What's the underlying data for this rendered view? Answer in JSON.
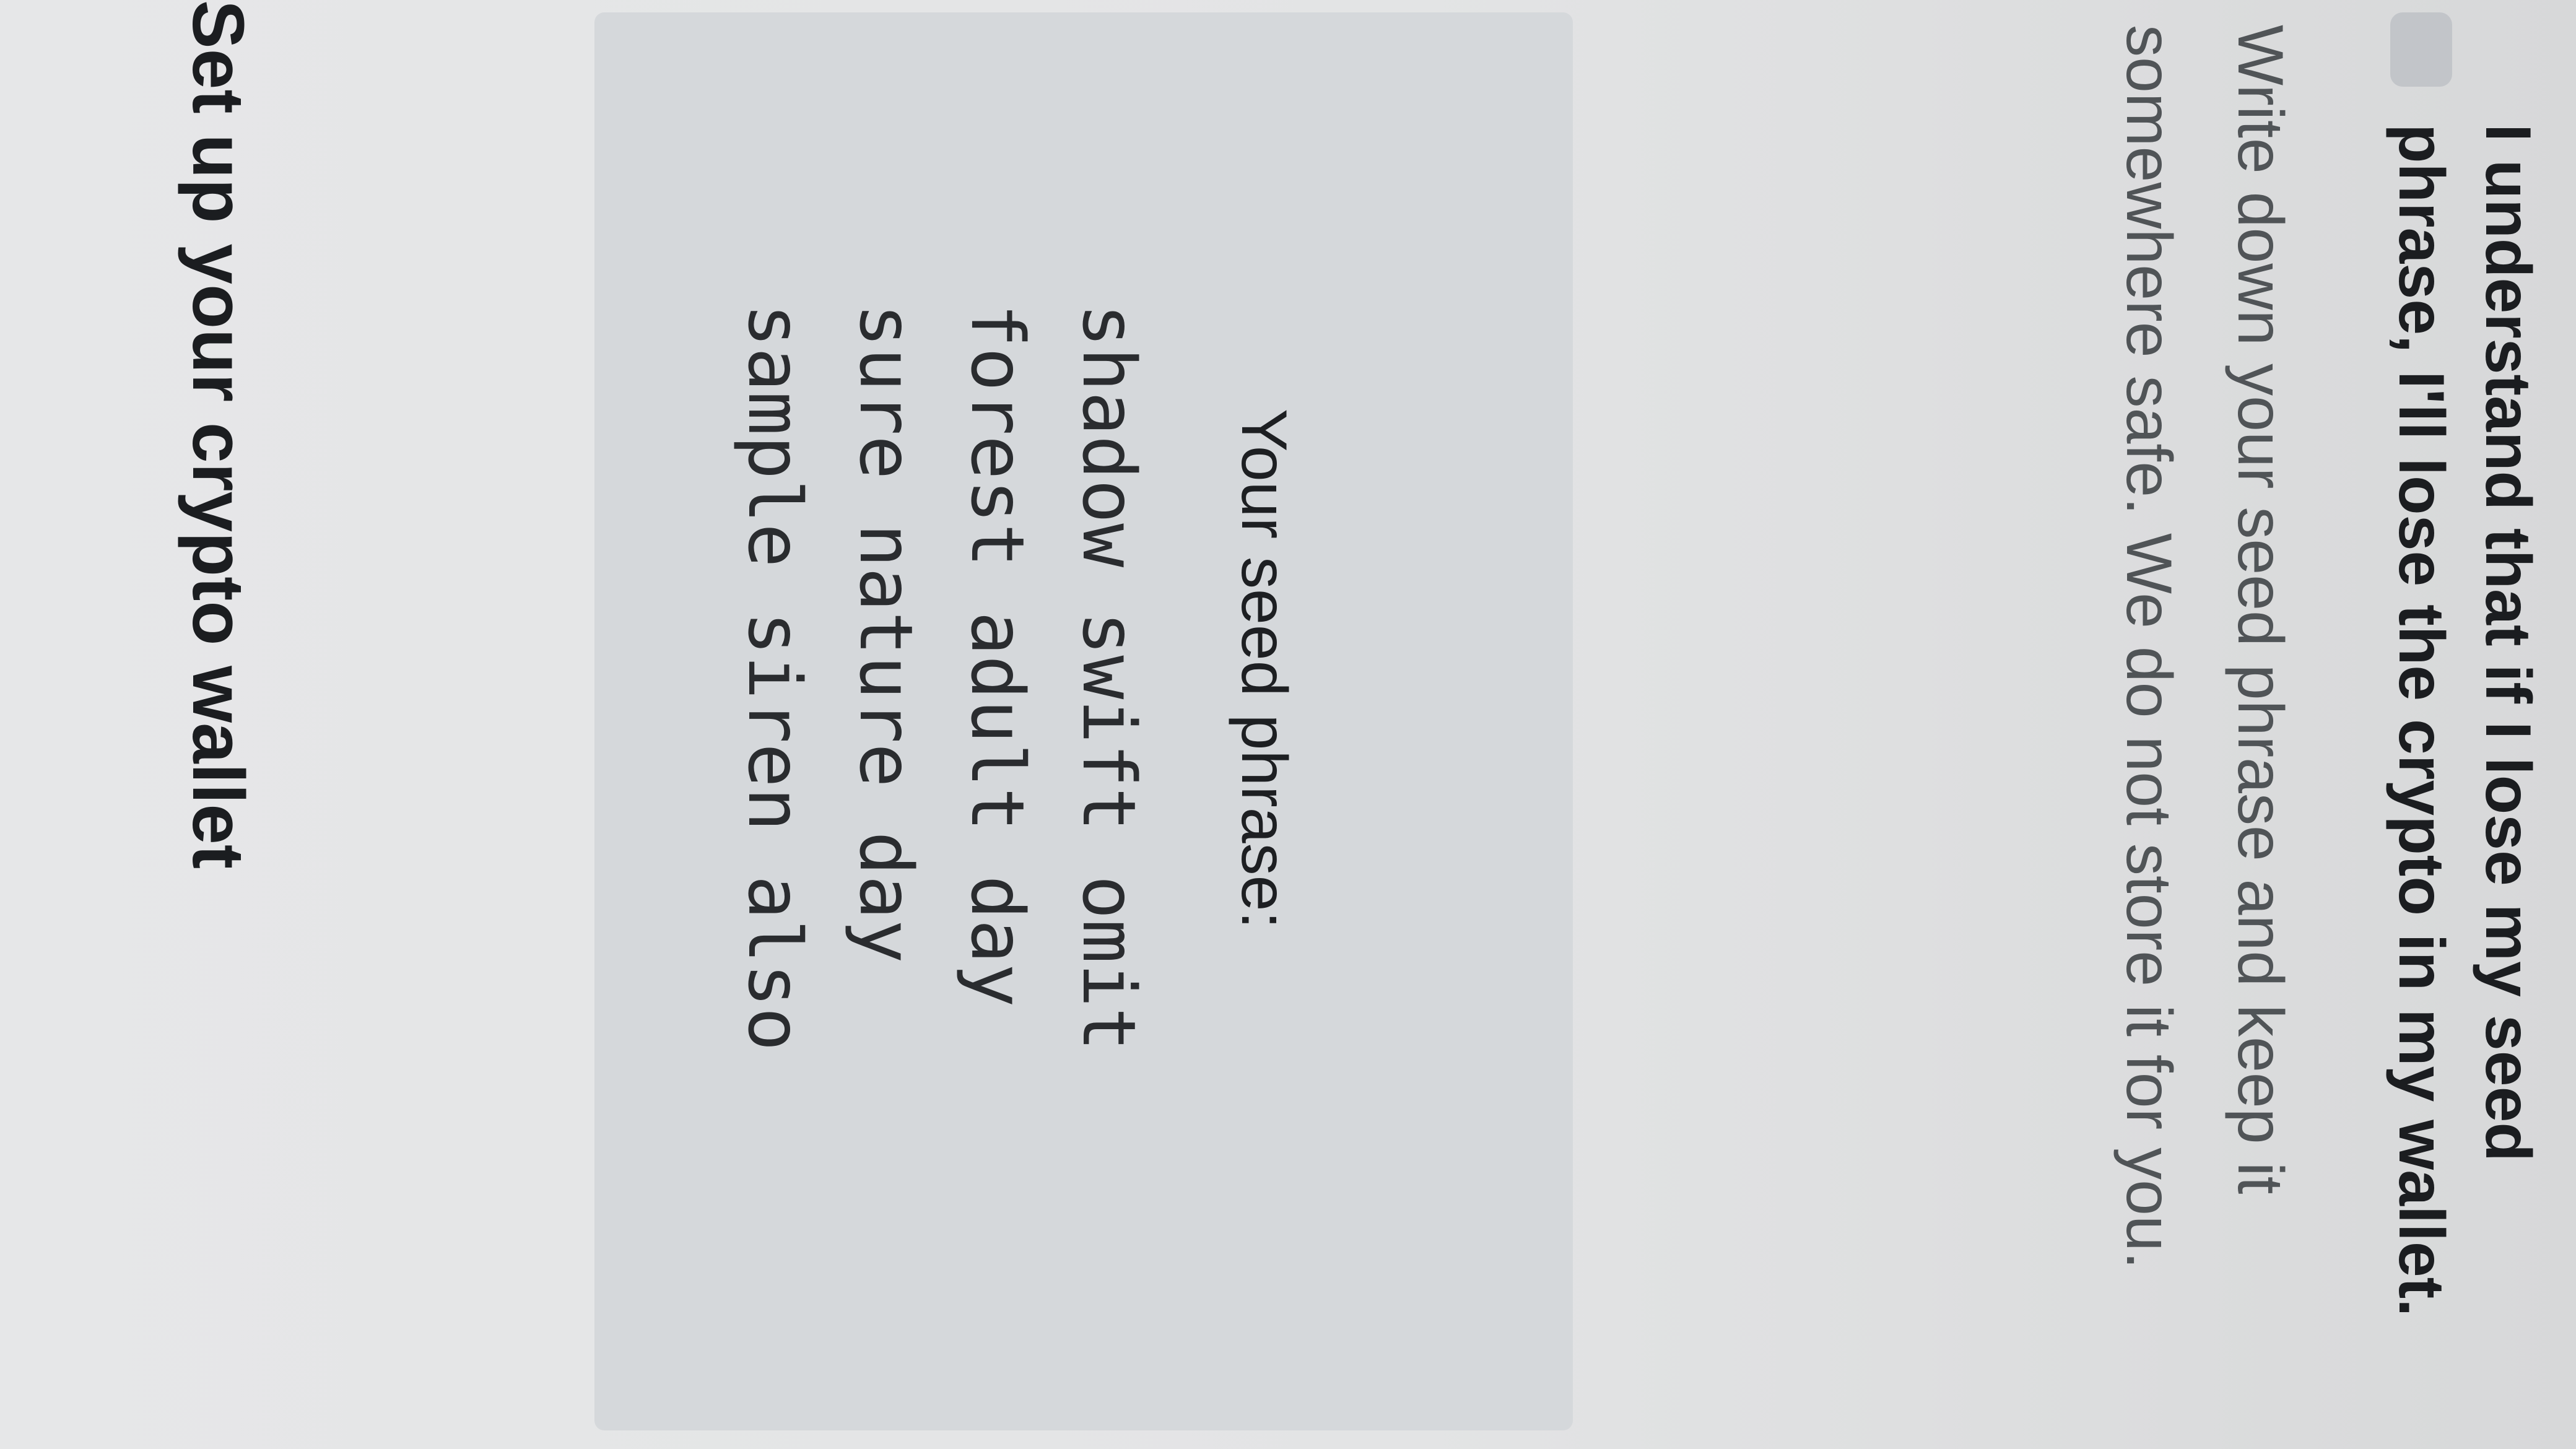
{
  "title": "Set up your crypto wallet",
  "seed": {
    "label": "Your seed phrase:",
    "lines": [
      "shadow swift omit",
      "forest adult day",
      "sure nature day",
      "sample siren also"
    ]
  },
  "instructions": "Write down your seed phrase and keep it somewhere safe. We do not store it for you.",
  "confirmation": {
    "checked": false,
    "label": "I understand that if I lose my seed phrase, I'll lose the crypto in my wallet."
  }
}
